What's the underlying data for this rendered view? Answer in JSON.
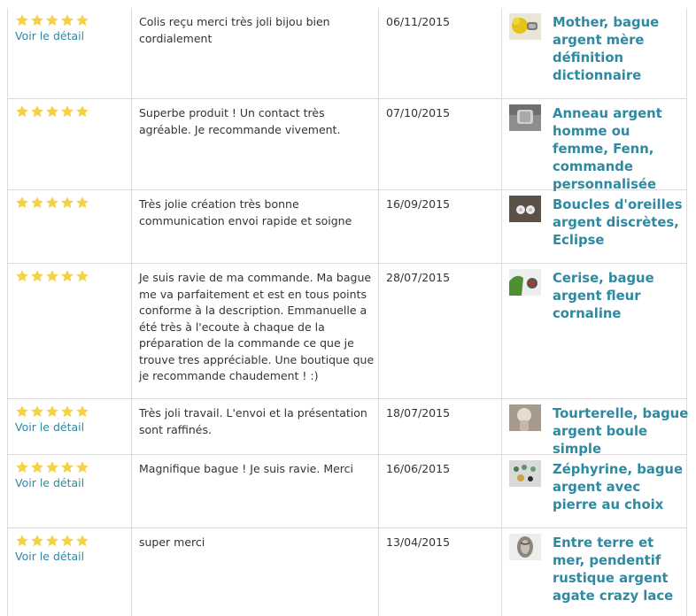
{
  "reviews": [
    {
      "rating": 5,
      "detail_label": "Voir le détail",
      "comment": "Colis reçu merci très joli bijou bien cordialement",
      "date": "06/11/2015",
      "product": "Mother, bague argent mère définition dictionnaire"
    },
    {
      "rating": 5,
      "detail_label": "",
      "comment": "Superbe produit ! Un contact très agréable. Je recommande vivement.",
      "date": "07/10/2015",
      "product": "Anneau argent homme ou femme, Fenn, commande personnalisée"
    },
    {
      "rating": 5,
      "detail_label": "",
      "comment": "Très jolie création très bonne communication envoi rapide et soigne",
      "date": "16/09/2015",
      "product": "Boucles d'oreilles argent discrètes, Eclipse"
    },
    {
      "rating": 5,
      "detail_label": "",
      "comment": "Je suis ravie de ma commande. Ma bague me va parfaitement et est en tous points conforme à la description. Emmanuelle a été très à l'ecoute à chaque de la préparation de la commande ce que je trouve tres appréciable. Une boutique que je recommande chaudement ! :)",
      "date": "28/07/2015",
      "product": "Cerise, bague argent fleur cornaline"
    },
    {
      "rating": 5,
      "detail_label": "Voir le détail",
      "comment": "Très joli travail. L'envoi et la présentation sont raffinés.",
      "date": "18/07/2015",
      "product": "Tourterelle, bague argent boule simple"
    },
    {
      "rating": 5,
      "detail_label": "Voir le détail",
      "comment": "Magnifique bague ! Je suis ravie. Merci",
      "date": "16/06/2015",
      "product": "Zéphyrine, bague argent avec pierre au choix"
    },
    {
      "rating": 5,
      "detail_label": "Voir le détail",
      "comment": "super merci",
      "date": "13/04/2015",
      "product": "Entre terre et mer, pendentif rustique argent agate crazy lace"
    }
  ],
  "colors": {
    "star": "#f5d245",
    "link": "#2e89a1",
    "border": "#dcdcdc",
    "text": "#333333"
  },
  "icons": {
    "star": "star-icon",
    "thumbnail": "product-thumbnail"
  }
}
